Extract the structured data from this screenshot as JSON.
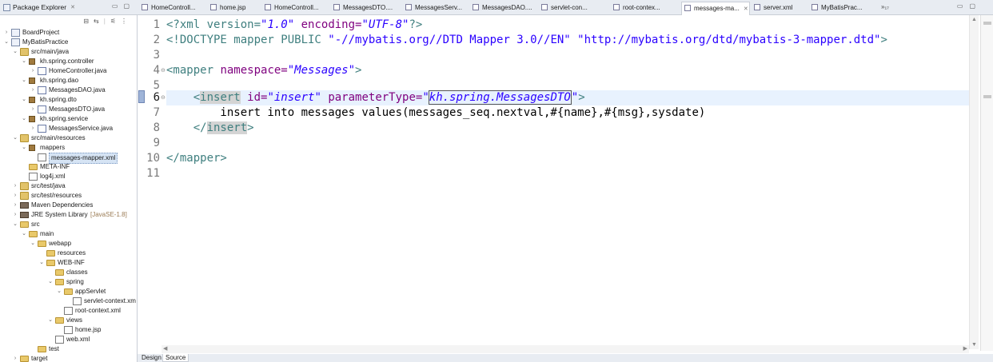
{
  "explorer": {
    "title": "Package Explorer",
    "close_glyph": "✕",
    "tree": [
      {
        "label": "BoardProject",
        "depth": 0,
        "twisty": "collapsed",
        "icon": "project-icon"
      },
      {
        "label": "MyBatisPractice",
        "depth": 0,
        "twisty": "expanded",
        "icon": "project-icon"
      },
      {
        "label": "src/main/java",
        "depth": 1,
        "twisty": "expanded",
        "icon": "source-folder-icon"
      },
      {
        "label": "kh.spring.controller",
        "depth": 2,
        "twisty": "expanded",
        "icon": "package-icon"
      },
      {
        "label": "HomeController.java",
        "depth": 3,
        "twisty": "collapsed",
        "icon": "java-file-icon"
      },
      {
        "label": "kh.spring.dao",
        "depth": 2,
        "twisty": "expanded",
        "icon": "package-icon"
      },
      {
        "label": "MessagesDAO.java",
        "depth": 3,
        "twisty": "collapsed",
        "icon": "java-file-icon"
      },
      {
        "label": "kh.spring.dto",
        "depth": 2,
        "twisty": "expanded",
        "icon": "package-icon"
      },
      {
        "label": "MessagesDTO.java",
        "depth": 3,
        "twisty": "collapsed",
        "icon": "java-file-icon"
      },
      {
        "label": "kh.spring.service",
        "depth": 2,
        "twisty": "expanded",
        "icon": "package-icon"
      },
      {
        "label": "MessagesService.java",
        "depth": 3,
        "twisty": "collapsed",
        "icon": "java-file-icon"
      },
      {
        "label": "src/main/resources",
        "depth": 1,
        "twisty": "expanded",
        "icon": "source-folder-icon"
      },
      {
        "label": "mappers",
        "depth": 2,
        "twisty": "expanded",
        "icon": "package-icon"
      },
      {
        "label": "messages-mapper.xml",
        "depth": 3,
        "twisty": "none",
        "icon": "xml-file-icon",
        "selected": true
      },
      {
        "label": "META-INF",
        "depth": 2,
        "twisty": "none",
        "icon": "folder-icon"
      },
      {
        "label": "log4j.xml",
        "depth": 2,
        "twisty": "none",
        "icon": "xml-file-icon"
      },
      {
        "label": "src/test/java",
        "depth": 1,
        "twisty": "collapsed",
        "icon": "source-folder-icon"
      },
      {
        "label": "src/test/resources",
        "depth": 1,
        "twisty": "collapsed",
        "icon": "source-folder-icon"
      },
      {
        "label": "Maven Dependencies",
        "depth": 1,
        "twisty": "collapsed",
        "icon": "library-icon"
      },
      {
        "label": "JRE System Library",
        "deco": "[JavaSE-1.8]",
        "depth": 1,
        "twisty": "collapsed",
        "icon": "library-icon"
      },
      {
        "label": "src",
        "depth": 1,
        "twisty": "expanded",
        "icon": "folder-icon"
      },
      {
        "label": "main",
        "depth": 2,
        "twisty": "expanded",
        "icon": "folder-icon"
      },
      {
        "label": "webapp",
        "depth": 3,
        "twisty": "expanded",
        "icon": "folder-icon"
      },
      {
        "label": "resources",
        "depth": 4,
        "twisty": "none",
        "icon": "folder-icon"
      },
      {
        "label": "WEB-INF",
        "depth": 4,
        "twisty": "expanded",
        "icon": "folder-icon"
      },
      {
        "label": "classes",
        "depth": 5,
        "twisty": "none",
        "icon": "folder-icon"
      },
      {
        "label": "spring",
        "depth": 5,
        "twisty": "expanded",
        "icon": "folder-icon"
      },
      {
        "label": "appServlet",
        "depth": 6,
        "twisty": "expanded",
        "icon": "folder-icon"
      },
      {
        "label": "servlet-context.xm",
        "depth": 7,
        "twisty": "none",
        "icon": "xml-file-icon"
      },
      {
        "label": "root-context.xml",
        "depth": 6,
        "twisty": "none",
        "icon": "xml-file-icon"
      },
      {
        "label": "views",
        "depth": 5,
        "twisty": "expanded",
        "icon": "folder-icon"
      },
      {
        "label": "home.jsp",
        "depth": 6,
        "twisty": "none",
        "icon": "jsp-file-icon"
      },
      {
        "label": "web.xml",
        "depth": 5,
        "twisty": "none",
        "icon": "xml-file-icon"
      },
      {
        "label": "test",
        "depth": 3,
        "twisty": "none",
        "icon": "folder-icon"
      },
      {
        "label": "target",
        "depth": 1,
        "twisty": "collapsed",
        "icon": "folder-icon"
      }
    ]
  },
  "tabs": [
    {
      "label": "HomeControll...",
      "icon": "java-file-icon"
    },
    {
      "label": "home.jsp",
      "icon": "jsp-file-icon"
    },
    {
      "label": "HomeControll...",
      "icon": "java-file-icon"
    },
    {
      "label": "MessagesDTO....",
      "icon": "java-file-icon"
    },
    {
      "label": "MessagesServ...",
      "icon": "java-file-icon"
    },
    {
      "label": "MessagesDAO....",
      "icon": "java-file-icon"
    },
    {
      "label": "servlet-con...",
      "icon": "xml-file-icon"
    },
    {
      "label": "root-contex...",
      "icon": "xml-file-icon"
    },
    {
      "label": "messages-ma...",
      "icon": "xml-file-icon",
      "active": true
    },
    {
      "label": "server.xml",
      "icon": "xml-file-icon"
    },
    {
      "label": "MyBatisPrac...",
      "icon": "project-icon"
    }
  ],
  "tabs_overflow": "»₁₇",
  "editor": {
    "current_line": 6,
    "line_numbers": [
      "1",
      "2",
      "3",
      "4",
      "5",
      "6",
      "7",
      "8",
      "9",
      "10",
      "11"
    ],
    "lines": {
      "l1": {
        "a": "<?xml version=",
        "b": "\"1.0\"",
        "c": " encoding=",
        "d": "\"UTF-8\"",
        "e": "?>"
      },
      "l2": {
        "a": "<!DOCTYPE mapper PUBLIC ",
        "b": "\"-//mybatis.org//DTD Mapper 3.0//EN\"",
        "c": " ",
        "d": "\"http://mybatis.org/dtd/mybatis-3-mapper.dtd\"",
        "e": ">"
      },
      "l4": {
        "a": "<mapper ",
        "b": "namespace=",
        "c": "\"Messages\"",
        "d": ">"
      },
      "l6": {
        "indent": "    ",
        "a": "<",
        "b": "insert",
        "c": " id=",
        "d": "\"insert\"",
        "e": " parameterType=",
        "f": "\"",
        "g": "kh.spring.MessagesDTO",
        "h": "\"",
        "i": ">"
      },
      "l7": {
        "text": "        insert into messages values(messages_seq.nextval,#{name},#{msg},sysdate)"
      },
      "l8": {
        "indent": "    ",
        "a": "</",
        "b": "insert",
        "c": ">"
      },
      "l10": {
        "a": "</mapper>"
      }
    }
  },
  "bottom_tabs": [
    "Design",
    "Source"
  ],
  "bottom_active": "Source"
}
